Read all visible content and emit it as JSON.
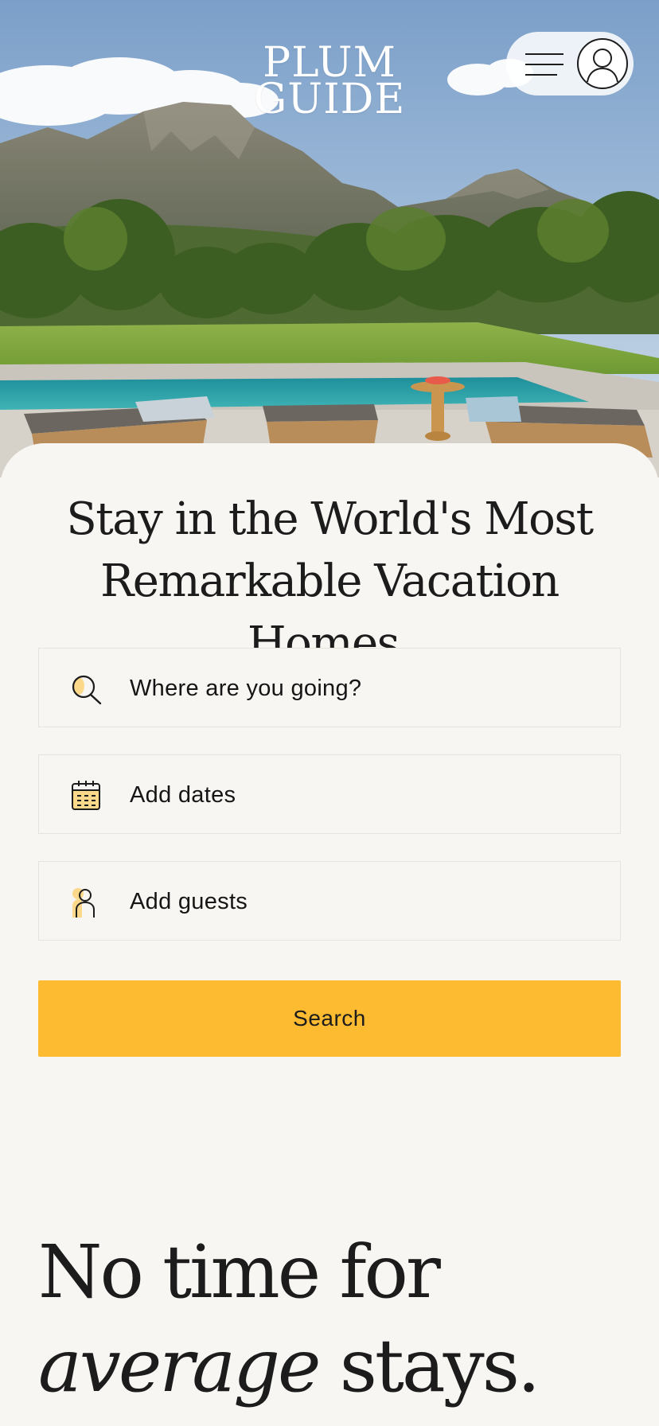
{
  "brand": {
    "logo_line1": "PLUM",
    "logo_line2": "GUIDE"
  },
  "header": {
    "menu_icon": "hamburger-menu-icon",
    "account_icon": "user-account-icon"
  },
  "hero": {
    "headline_line1": "Stay in the World's Most",
    "headline_line2": "Remarkable Vacation Homes."
  },
  "search_form": {
    "destination": {
      "label": "Where are you going?",
      "icon": "search-icon"
    },
    "dates": {
      "label": "Add dates",
      "icon": "calendar-icon"
    },
    "guests": {
      "label": "Add guests",
      "icon": "guest-person-icon"
    },
    "submit_label": "Search"
  },
  "tagline": {
    "line1": "No time for",
    "emphasis": "average",
    "rest": "stays."
  },
  "colors": {
    "accent": "#fdbb31",
    "background": "#f8f6f3",
    "text": "#1c1c1c",
    "icon_highlight": "#fbd88a"
  }
}
